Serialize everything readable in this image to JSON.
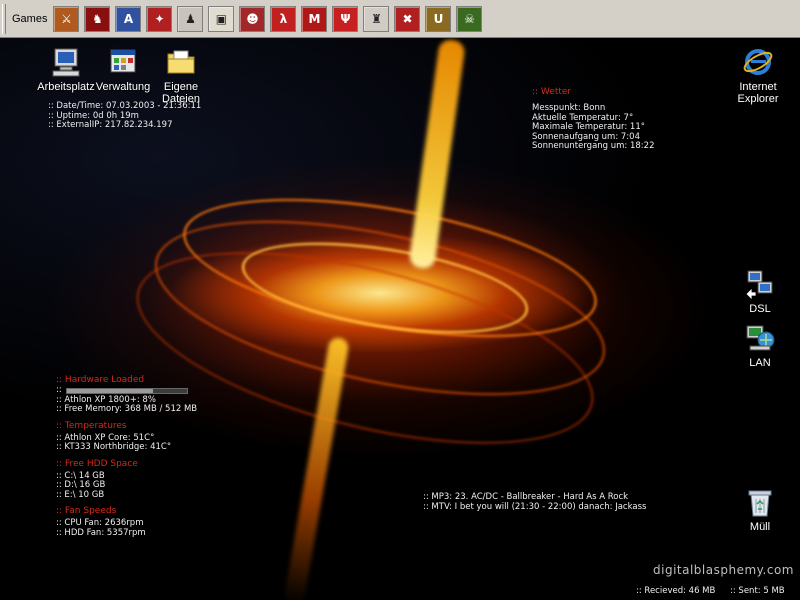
{
  "quicklaunch": {
    "title": "Games",
    "icons": [
      {
        "name": "warrior-icon",
        "color": "#b05a20",
        "glyph": "⚔"
      },
      {
        "name": "knight-helmet-icon",
        "color": "#8a1010",
        "glyph": "♞"
      },
      {
        "name": "wings-a-icon",
        "color": "#3050a0",
        "glyph": "A"
      },
      {
        "name": "star-emblem-icon",
        "color": "#b02020",
        "glyph": "✦"
      },
      {
        "name": "soldier-silhouette-icon",
        "color": "#c8c4bc",
        "glyph": "♟"
      },
      {
        "name": "robot-icon",
        "color": "#e0dcd0",
        "glyph": "▣"
      },
      {
        "name": "face-icon",
        "color": "#a02828",
        "glyph": "☻"
      },
      {
        "name": "half-life-lambda-icon",
        "color": "#c02020",
        "glyph": "λ"
      },
      {
        "name": "mafia-icon",
        "color": "#b01818",
        "glyph": "M"
      },
      {
        "name": "quake-emblem-icon",
        "color": "#c82020",
        "glyph": "Ψ"
      },
      {
        "name": "soldier-figure-icon",
        "color": "#d0ccc4",
        "glyph": "♜"
      },
      {
        "name": "red-crosshair-icon",
        "color": "#b02020",
        "glyph": "✖"
      },
      {
        "name": "unreal-u-icon",
        "color": "#8a6a20",
        "glyph": "U"
      },
      {
        "name": "green-monster-icon",
        "color": "#3a6a20",
        "glyph": "☠"
      }
    ]
  },
  "desktop": {
    "arbeitsplatz": "Arbeitsplatz",
    "verwaltung": "Verwaltung",
    "eigene_dateien": "Eigene Dateien",
    "internet_explorer": "Internet Explorer",
    "dsl": "DSL",
    "lan": "LAN",
    "muell": "Müll"
  },
  "system": {
    "date": ":: Date/Time: 07.03.2003 - 21:36:11",
    "uptime": ":: Uptime: 0d 0h 19m",
    "ip": ":: ExternalIP: 217.82.234.197"
  },
  "wetter": {
    "head": ":: Wetter",
    "lines": [
      "Messpunkt: Bonn",
      "Aktuelle Temperatur: 7°",
      "Maximale Temperatur: 11°",
      "Sonnenaufgang um: 7:04",
      "Sonnenuntergang um: 18:22"
    ]
  },
  "hardware": {
    "head": ":: Hardware Loaded",
    "memory_used_fraction": 0.72,
    "cpu": ":: Athlon XP 1800+: 8%",
    "memory": ":: Free Memory: 368 MB / 512 MB"
  },
  "temperatures": {
    "head": ":: Temperatures",
    "core": ":: Athlon XP Core: 51C°",
    "northbridge": ":: KT333 Northbridge: 41C°"
  },
  "hdd": {
    "head": ":: Free HDD Space",
    "c": ":: C:\\ 14 GB",
    "d": ":: D:\\ 16 GB",
    "e": ":: E:\\ 10 GB"
  },
  "fans": {
    "head": ":: Fan Speeds",
    "cpu": ":: CPU Fan: 2636rpm",
    "hdd": ":: HDD Fan: 5357rpm"
  },
  "media": {
    "mp3": ":: MP3: 23. AC/DC - Ballbreaker - Hard As A Rock",
    "mtv": ":: MTV: I bet you will (21:30 - 22:00) danach: Jackass"
  },
  "watermark": "digitalblasphemy.com",
  "net": {
    "received": ":: Recieved: 46 MB",
    "sent": ":: Sent: 5 MB"
  }
}
